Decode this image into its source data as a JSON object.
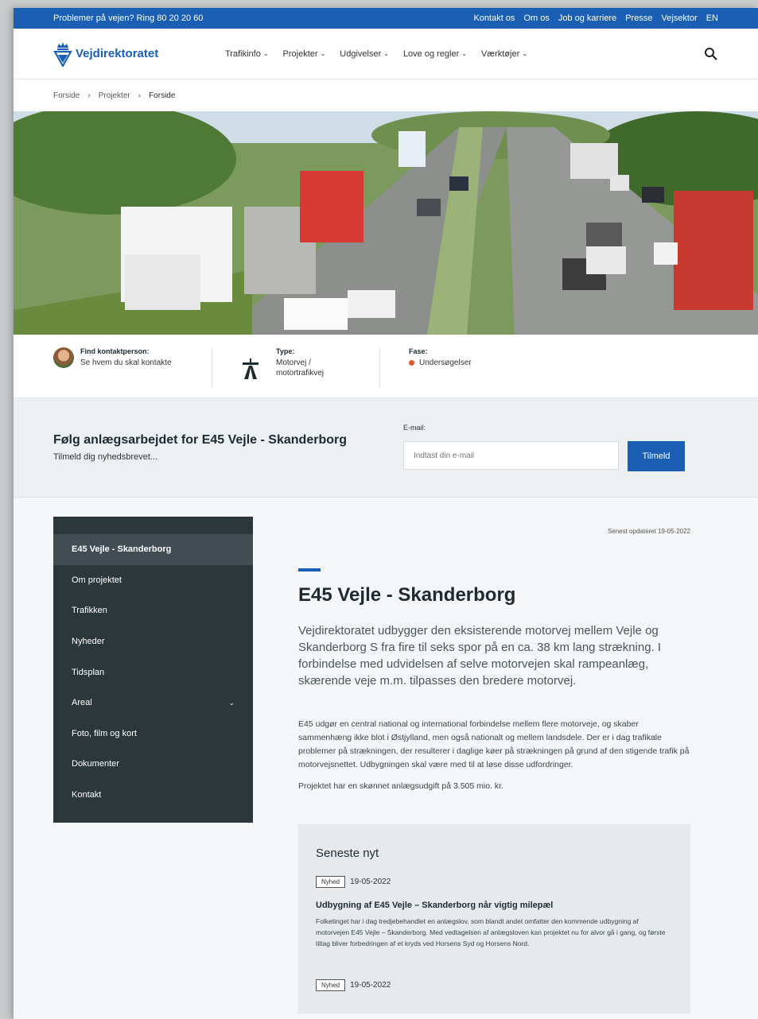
{
  "topbar": {
    "hotline": "Problemer på vejen? Ring 80 20 20 60",
    "links": [
      "Kontakt os",
      "Om os",
      "Job og karriere",
      "Presse",
      "Vejsektor",
      "EN"
    ]
  },
  "header": {
    "logo_text": "Vejdirektoratet",
    "nav": [
      "Trafikinfo",
      "Projekter",
      "Udgivelser",
      "Love og regler",
      "Værktøjer"
    ]
  },
  "breadcrumb": [
    "Forside",
    "Projekter",
    "Forside"
  ],
  "info": {
    "contact_label": "Find kontaktperson:",
    "contact_value": "Se hvem du skal kontakte",
    "type_label": "Type:",
    "type_value": "Motorvej / motortrafikvej",
    "phase_label": "Fase:",
    "phase_value": "Undersøgelser"
  },
  "subscribe": {
    "title": "Følg anlægsarbejdet for E45 Vejle - Skanderborg",
    "text": "Tilmeld dig nyhedsbrevet...",
    "email_label": "E-mail:",
    "email_placeholder": "Indtast din e-mail",
    "button": "Tilmeld"
  },
  "sidebar": [
    "E45 Vejle - Skanderborg",
    "Om projektet",
    "Trafikken",
    "Nyheder",
    "Tidsplan",
    "Areal",
    "Foto, film og kort",
    "Dokumenter",
    "Kontakt"
  ],
  "main": {
    "updated": "Senest opdateret 19-05-2022",
    "title": "E45 Vejle - Skanderborg",
    "lead": "Vejdirektoratet udbygger den eksisterende motorvej mellem Vejle og Skanderborg S fra fire til seks spor på en ca. 38 km lang strækning. I forbindelse med udvidelsen af selve motorvejen skal rampeanlæg, skærende veje m.m. tilpasses den bredere motorvej.",
    "body": "E45 udgør en central national og international forbindelse mellem flere motorveje, og skaber sammenhæng ikke blot i Østjylland, men også nationalt og mellem landsdele. Der er i dag trafikale problemer på strækningen, der resulterer i daglige køer på strækningen på grund af den stigende trafik på motorvejsnettet. Udbygningen skal være med til at løse disse udfordringer.",
    "cost": "Projektet har en skønnet anlægsudgift på 3.505 mio. kr."
  },
  "news": {
    "heading": "Seneste nyt",
    "items": [
      {
        "tag": "Nyhed",
        "date": "19-05-2022",
        "title": "Udbygning af E45 Vejle – Skanderborg når vigtig milepæl",
        "text": "Folketinget har i dag tredjebehandlet en anlægslov, som blandt andet omfatter den kommende udbygning af motorvejen E45 Vejle – Skanderborg. Med vedtagelsen af anlægsloven kan projektet nu for alvor gå i gang, og første tiltag bliver forbedringen af et kryds ved Horsens Syd og Horsens Nord."
      },
      {
        "tag": "Nyhed",
        "date": "19-05-2022"
      }
    ]
  },
  "colors": {
    "brand_blue": "#1a5fb4",
    "sidebar_bg": "#2b373b",
    "phase_dot": "#e2552b"
  }
}
